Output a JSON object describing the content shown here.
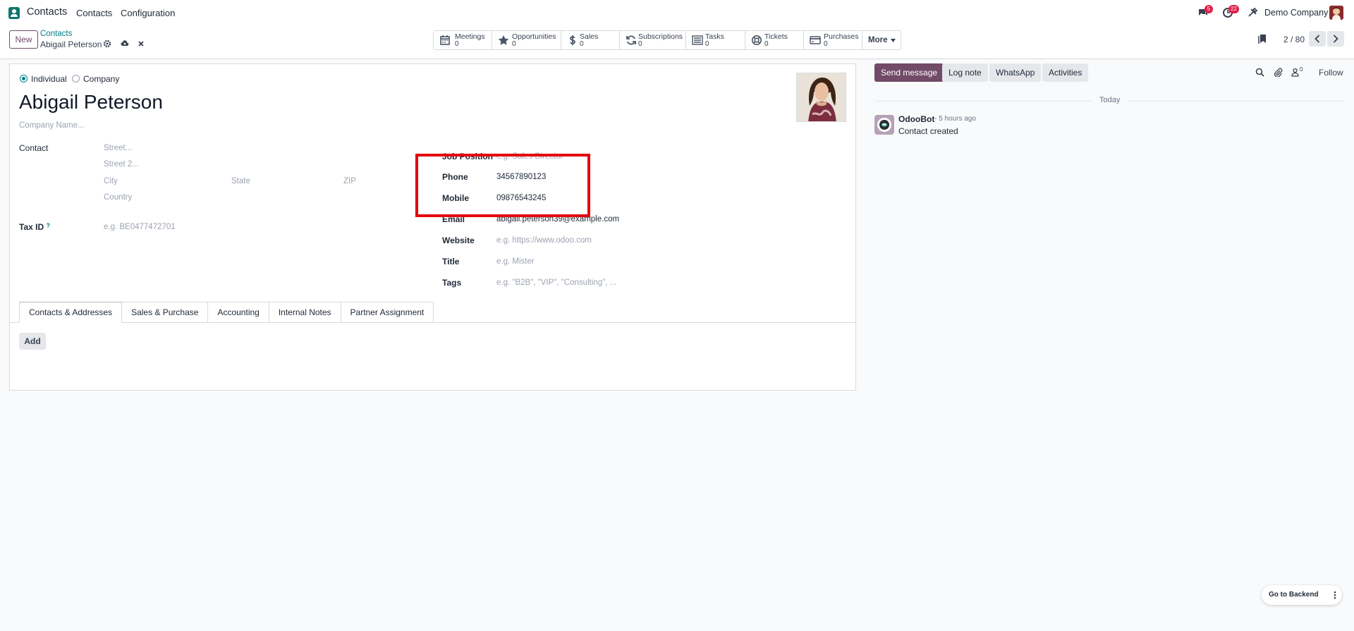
{
  "navbar": {
    "app_name": "Contacts",
    "menu": [
      "Contacts",
      "Configuration"
    ],
    "messages_badge": "5",
    "activities_badge": "22",
    "company": "Demo Company",
    "icons": [
      "chat-icon",
      "clock-icon",
      "tools-icon"
    ]
  },
  "control_panel": {
    "new_label": "New",
    "breadcrumb_parent": "Contacts",
    "breadcrumb_current": "Abigail Peterson",
    "smart_buttons": [
      {
        "label": "Meetings",
        "count": "0",
        "icon": "calendar-icon"
      },
      {
        "label": "Opportunities",
        "count": "0",
        "icon": "star-icon"
      },
      {
        "label": "Sales",
        "count": "0",
        "icon": "dollar-icon"
      },
      {
        "label": "Subscriptions",
        "count": "0",
        "icon": "refresh-icon"
      },
      {
        "label": "Tasks",
        "count": "0",
        "icon": "tasks-icon"
      },
      {
        "label": "Tickets",
        "count": "0",
        "icon": "life-ring-icon"
      },
      {
        "label": "Purchases",
        "count": "0",
        "icon": "credit-card-icon"
      }
    ],
    "more_label": "More",
    "pager": "2 / 80"
  },
  "form": {
    "type_options": [
      "Individual",
      "Company"
    ],
    "type_selected": "Individual",
    "name": "Abigail Peterson",
    "company_placeholder": "Company Name...",
    "contact_label": "Contact",
    "address": {
      "street": "Street...",
      "street2": "Street 2...",
      "city": "City",
      "state": "State",
      "zip": "ZIP",
      "country": "Country"
    },
    "tax_id_label": "Tax ID",
    "tax_id_tooltip": "?",
    "tax_id_placeholder": "e.g. BE0477472701",
    "job_position_label": "Job Position",
    "job_position_placeholder": "e.g. Sales Director",
    "phone_label": "Phone",
    "phone_value": "34567890123",
    "mobile_label": "Mobile",
    "mobile_value": "09876543245",
    "email_label": "Email",
    "email_value": "abigail.peterson39@example.com",
    "website_label": "Website",
    "website_placeholder": "e.g. https://www.odoo.com",
    "title_label": "Title",
    "title_placeholder": "e.g. Mister",
    "tags_label": "Tags",
    "tags_placeholder": "e.g. \"B2B\", \"VIP\", \"Consulting\", ...",
    "tabs": [
      "Contacts & Addresses",
      "Sales & Purchase",
      "Accounting",
      "Internal Notes",
      "Partner Assignment"
    ],
    "active_tab": "Contacts & Addresses",
    "add_label": "Add"
  },
  "chatter": {
    "send_message": "Send message",
    "log_note": "Log note",
    "whatsapp": "WhatsApp",
    "activities": "Activities",
    "followers_count": "0",
    "follow": "Follow",
    "date_separator": "Today",
    "message": {
      "author": "OdooBot",
      "time": "- 5 hours ago",
      "body": "Contact created"
    }
  },
  "floating": {
    "go_backend": "Go to Backend"
  },
  "colors": {
    "brand": "#714b67",
    "accent": "#017e84",
    "highlight": "#e3000f",
    "badge": "#e11d48"
  }
}
